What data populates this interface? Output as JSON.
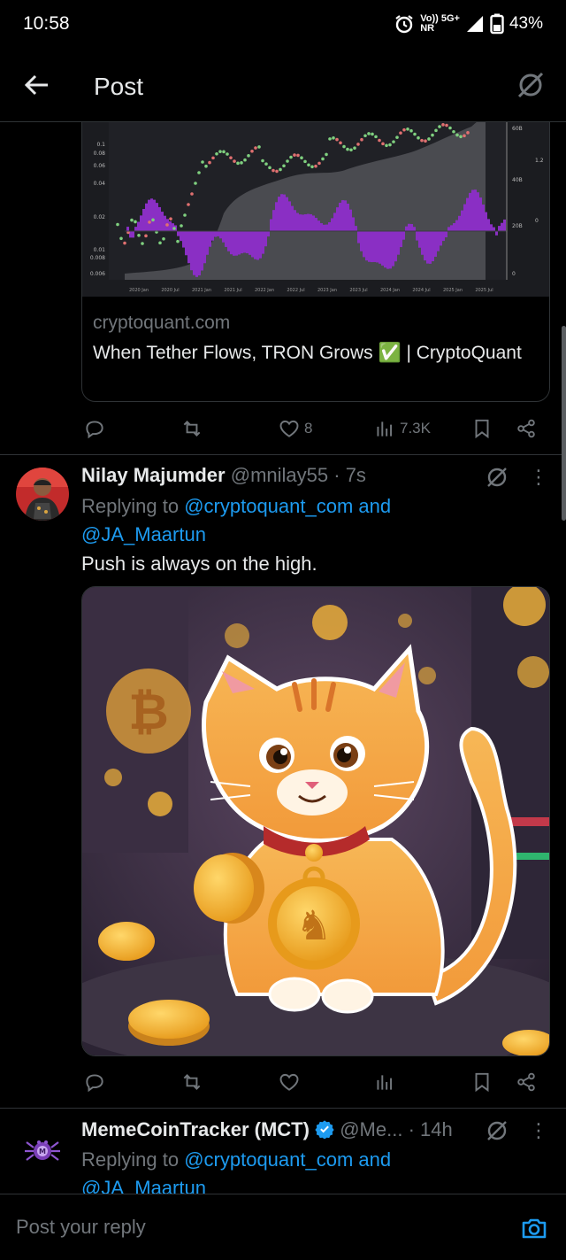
{
  "status": {
    "time": "10:58",
    "net_top": "Vo)) 5G+",
    "net_bottom": "NR",
    "battery": "43%"
  },
  "header": {
    "title": "Post"
  },
  "link_card": {
    "domain": "cryptoquant.com",
    "title": "When Tether Flows, TRON Grows ✅ | CryptoQuant",
    "chart_left_ticks": [
      "0.1",
      "0.08",
      "0.06",
      "0.04",
      "0.02",
      "0.01",
      "0.008",
      "0.006"
    ],
    "chart_right_ticks_a": [
      "60B",
      "40B",
      "20B",
      "0"
    ],
    "chart_right_ticks_b": [
      "1.2",
      "0"
    ],
    "chart_x_ticks": [
      "2020 Jan",
      "2020 Jul",
      "2021 Jan",
      "2021 Jul",
      "2022 Jan",
      "2022 Jul",
      "2023 Jan",
      "2023 Jul",
      "2024 Jan",
      "2024 Jul",
      "2025 Jan",
      "2025 Jul"
    ]
  },
  "card_actions": {
    "likes": "8",
    "views": "7.3K"
  },
  "tweet1": {
    "name": "Nilay Majumder",
    "handle": "@mnilay55",
    "time": "· 7s",
    "replying_prefix": "Replying to",
    "mention1": "@cryptoquant_com",
    "and": "and",
    "mention2": "@JA_Maartun",
    "text": "Push is always on the high."
  },
  "tweet2": {
    "name": "MemeCoinTracker (MCT)",
    "handle": "@Me...",
    "time": "· 14h",
    "replying_prefix": "Replying to",
    "mention1": "@cryptoquant_com",
    "and": "and",
    "mention2": "@JA_Maartun"
  },
  "reply_bar": {
    "placeholder": "Post your reply"
  },
  "colors": {
    "accent": "#1d9bf0",
    "muted": "#71767b",
    "border": "#2f3336",
    "verified": "#1d9bf0"
  }
}
